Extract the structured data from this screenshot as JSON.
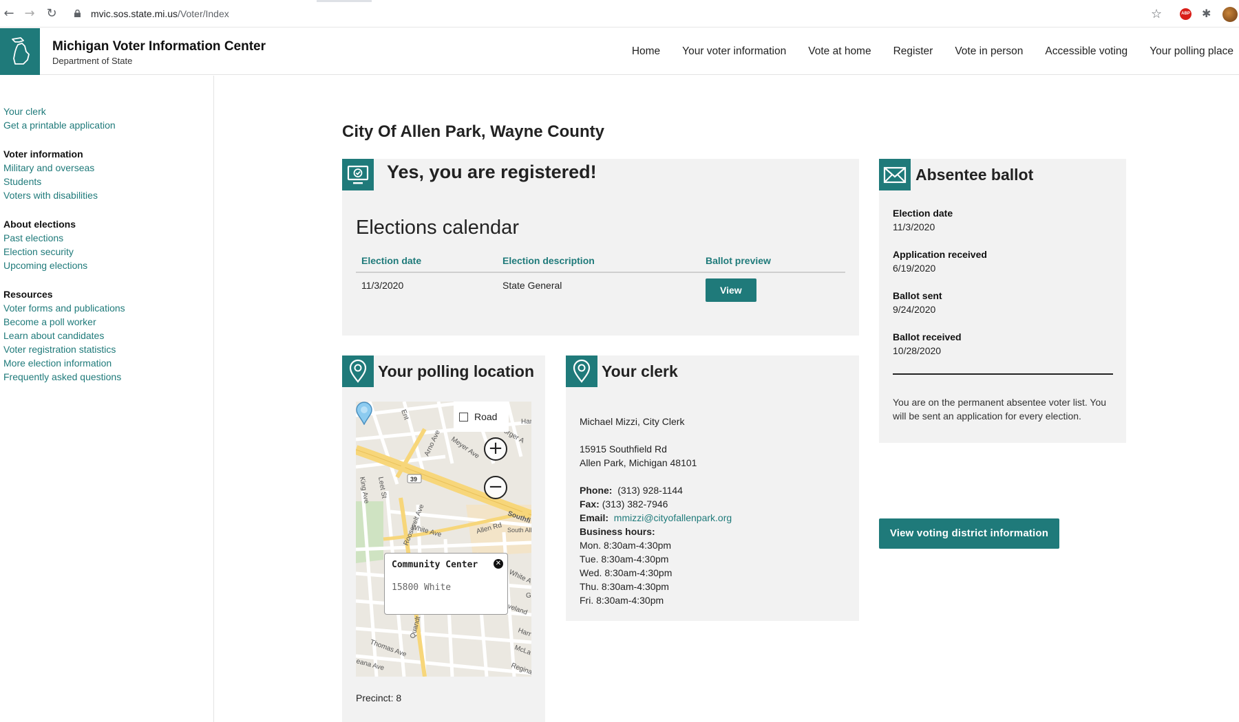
{
  "browser": {
    "url_domain": "mvic.sos.state.mi.us",
    "url_path": "/Voter/Index"
  },
  "header": {
    "title": "Michigan Voter Information Center",
    "subtitle": "Department of State",
    "nav": [
      "Home",
      "Your voter information",
      "Vote at home",
      "Register",
      "Vote in person",
      "Accessible voting",
      "Your polling place"
    ]
  },
  "sidebar": {
    "top_links": [
      "Your clerk",
      "Get a printable application"
    ],
    "groups": [
      {
        "title": "Voter information",
        "links": [
          "Military and overseas",
          "Students",
          "Voters with disabilities"
        ]
      },
      {
        "title": "About elections",
        "links": [
          "Past elections",
          "Election security",
          "Upcoming elections"
        ]
      },
      {
        "title": "Resources",
        "links": [
          "Voter forms and publications",
          "Become a poll worker",
          "Learn about candidates",
          "Voter registration statistics",
          "More election information",
          "Frequently asked questions"
        ]
      }
    ]
  },
  "main": {
    "city_title": "City Of Allen Park, Wayne County",
    "registered_title": "Yes, you are registered!",
    "calendar": {
      "title": "Elections calendar",
      "headers": [
        "Election date",
        "Election description",
        "Ballot preview"
      ],
      "rows": [
        {
          "date": "11/3/2020",
          "description": "State General",
          "button": "View"
        }
      ]
    },
    "absentee": {
      "title": "Absentee ballot",
      "items": [
        {
          "label": "Election date",
          "value": "11/3/2020"
        },
        {
          "label": "Application received",
          "value": "6/19/2020"
        },
        {
          "label": "Ballot sent",
          "value": "9/24/2020"
        },
        {
          "label": "Ballot received",
          "value": "10/28/2020"
        }
      ],
      "note": "You are on the permanent absentee voter list. You will be sent an application for every election."
    },
    "district_button": "View voting district information",
    "polling": {
      "title": "Your polling location",
      "map_toggle": "Road",
      "popup_name": "Community Center",
      "popup_address": "15800 White",
      "precinct": "Precinct: 8",
      "street_labels": [
        "Ent",
        "Arno Ave",
        "Meyer Ave",
        "Jorger A",
        "Har",
        "King Ave",
        "Leet St",
        "39",
        "Roosevelt Ave",
        "White Ave",
        "Allen Rd",
        "Southfi",
        "South Allen Center",
        "White Ave",
        "G",
        "veland",
        "Harr",
        "McLa",
        "Regina",
        "Thomas Ave",
        "Quandt",
        "eana Ave"
      ]
    },
    "clerk": {
      "title": "Your clerk",
      "name": "Michael Mizzi, City Clerk",
      "address1": "15915 Southfield Rd",
      "address2": "Allen Park, Michigan 48101",
      "phone_label": "Phone:",
      "phone": "(313) 928-1144",
      "fax_label": "Fax:",
      "fax": "(313) 382-7946",
      "email_label": "Email:",
      "email": "mmizzi@cityofallenpark.org",
      "hours_label": "Business hours:",
      "hours": [
        "Mon. 8:30am-4:30pm",
        "Tue. 8:30am-4:30pm",
        "Wed. 8:30am-4:30pm",
        "Thu. 8:30am-4:30pm",
        "Fri. 8:30am-4:30pm"
      ]
    }
  },
  "colors": {
    "accent": "#1f7a7a",
    "panel": "#f2f2f2"
  }
}
